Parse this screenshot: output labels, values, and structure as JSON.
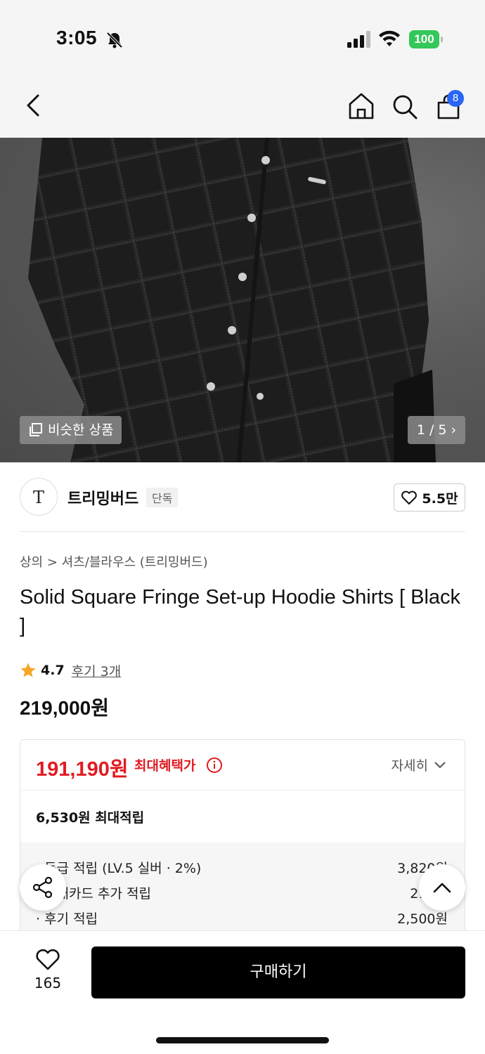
{
  "status_bar": {
    "time": "3:05",
    "battery": "100"
  },
  "nav": {
    "cart_count": "8"
  },
  "hero": {
    "similar_label": "비슷한 상품",
    "page_counter": "1 / 5 ›"
  },
  "brand": {
    "logo_text": "T",
    "name": "트리밍버드",
    "exclusive": "단독",
    "likes": "5.5만"
  },
  "product": {
    "breadcrumb": "상의 > 셔츠/블라우스 (트리밍버드)",
    "title": "Solid Square Fringe Set-up Hoodie Shirts [ Black ]",
    "rating": "4.7",
    "review_link": "후기 3개",
    "price": "219,000원"
  },
  "benefit": {
    "max_price": "191,190원",
    "max_label": "최대혜택가",
    "detail_label": "자세히",
    "max_points": "6,530원 최대적립",
    "rows": [
      {
        "label": "· 등급 적립 (LV.5 실버 · 2%)",
        "value": "3,820원"
      },
      {
        "label": "· 현대카드 추가 적립",
        "value": "210원"
      },
      {
        "label": "· 후기 적립",
        "value": "2,500원"
      }
    ]
  },
  "bottom": {
    "wish_count": "165",
    "buy_label": "구매하기"
  },
  "colors": {
    "accent_red": "#e11b22",
    "badge_blue": "#2a65f5",
    "battery_green": "#34c759"
  }
}
